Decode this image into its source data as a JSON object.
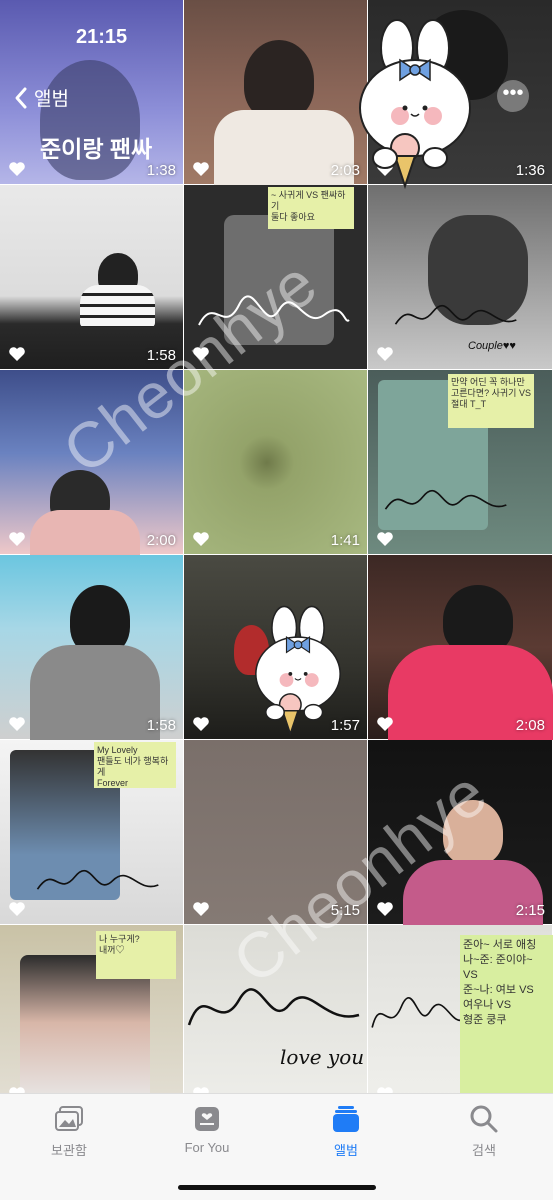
{
  "status_bar": {
    "time": "21:15"
  },
  "header": {
    "back_label": "앨범",
    "album_title": "준이랑 팬싸"
  },
  "watermark": "Cheonhye",
  "grid": {
    "items": [
      {
        "duration": "1:38"
      },
      {
        "duration": "2:03"
      },
      {
        "duration": "1:36"
      },
      {
        "duration": "1:58"
      },
      {
        "duration": ""
      },
      {
        "duration": ""
      },
      {
        "duration": "2:00"
      },
      {
        "duration": "1:41"
      },
      {
        "duration": ""
      },
      {
        "duration": "1:58"
      },
      {
        "duration": "1:57"
      },
      {
        "duration": "2:08"
      },
      {
        "duration": ""
      },
      {
        "duration": "5:15"
      },
      {
        "duration": "2:15"
      },
      {
        "duration": ""
      },
      {
        "duration": ""
      },
      {
        "duration": ""
      }
    ]
  },
  "notes": {
    "n1": "~ 사귀게 VS 팬싸하기\n둘다 좋아요",
    "n2": "만약 어딘 꼭 하나만\n고른다면? 사귀기 VS\n절대 T_T",
    "n3": "My Lovely\n팬들도 네가 행복하게\nForever",
    "n4": "나 누구게?\n내꺼♡",
    "n5": "준아~ 서로 애칭\n나~준: 준이야~\nVS\n준~나: 여보 VS\n여우나 VS\n형준 쿵쿠"
  },
  "sig_texts": {
    "couple": "Couple♥♥",
    "love": "love you"
  },
  "tabs": [
    {
      "label": "보관함"
    },
    {
      "label": "For You"
    },
    {
      "label": "앨범"
    },
    {
      "label": "검색"
    }
  ],
  "colors": {
    "accent": "#1f7cf6",
    "tab_inactive": "#8a8a8e"
  }
}
